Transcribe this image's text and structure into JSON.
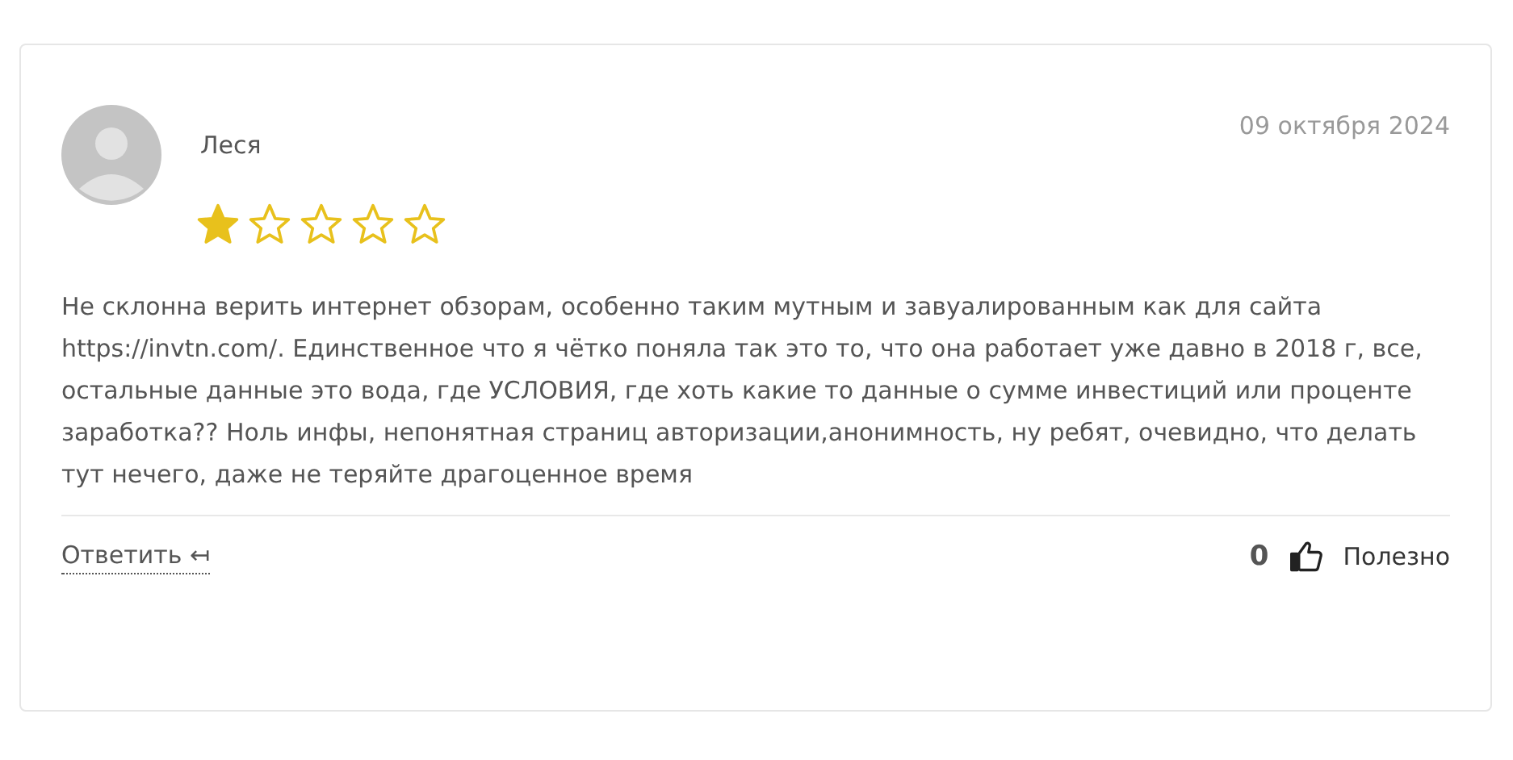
{
  "review": {
    "author": "Леся",
    "date": "09 октября 2024",
    "stars": 1,
    "text": "Не склонна верить интернет обзорам, особенно таким мутным и завуалированным как для сайта https://invtn.com/. Единственное что я чётко поняла так это то, что она работает уже давно в 2018 г, все, остальные данные это вода, где УСЛОВИЯ, где хоть какие то данные о сумме инвестиций или проценте заработка?? Ноль инфы, непонятная страниц авторизации,анонимность, ну ребят, очевидно, что делать тут нечего, даже не теряйте драгоценное время",
    "reply_label": "Ответить",
    "reply_icon": "↤",
    "likes": "0",
    "useful_label": "Полезно"
  }
}
